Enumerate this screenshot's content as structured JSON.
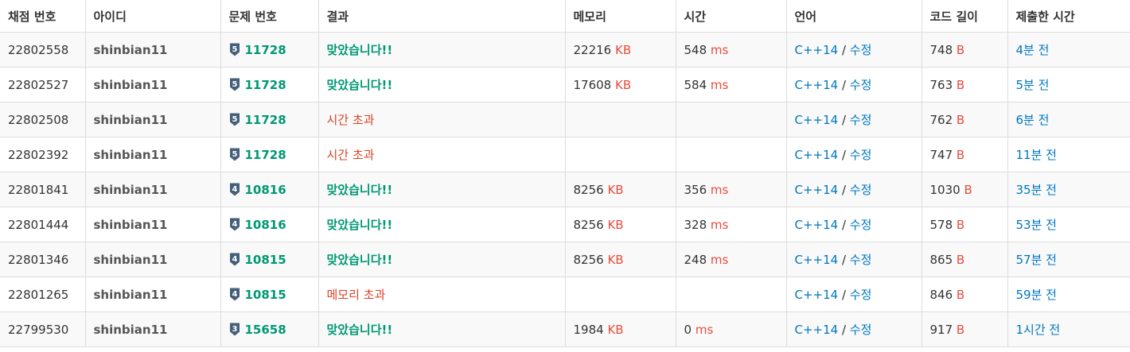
{
  "colors": {
    "accepted": "#009874",
    "fail": "#dd4124",
    "unit": "#e74c3c",
    "link": "#0076c0",
    "tier_badge": "#435f7a"
  },
  "headers": [
    "채점 번호",
    "아이디",
    "문제 번호",
    "결과",
    "메모리",
    "시간",
    "언어",
    "코드 길이",
    "제출한 시간"
  ],
  "rows": [
    {
      "id": "22802558",
      "user": "shinbian11",
      "tier": "5",
      "problem": "11728",
      "result": "맞았습니다!!",
      "status": "ok",
      "memory": "22216",
      "memory_unit": "KB",
      "time": "548",
      "time_unit": "ms",
      "lang": "C++14",
      "sep": " / ",
      "edit": "수정",
      "length": "748",
      "length_unit": "B",
      "ago": "4분 전"
    },
    {
      "id": "22802527",
      "user": "shinbian11",
      "tier": "5",
      "problem": "11728",
      "result": "맞았습니다!!",
      "status": "ok",
      "memory": "17608",
      "memory_unit": "KB",
      "time": "584",
      "time_unit": "ms",
      "lang": "C++14",
      "sep": " / ",
      "edit": "수정",
      "length": "763",
      "length_unit": "B",
      "ago": "5분 전"
    },
    {
      "id": "22802508",
      "user": "shinbian11",
      "tier": "5",
      "problem": "11728",
      "result": "시간 초과",
      "status": "fail",
      "memory": "",
      "memory_unit": "",
      "time": "",
      "time_unit": "",
      "lang": "C++14",
      "sep": " / ",
      "edit": "수정",
      "length": "762",
      "length_unit": "B",
      "ago": "6분 전"
    },
    {
      "id": "22802392",
      "user": "shinbian11",
      "tier": "5",
      "problem": "11728",
      "result": "시간 초과",
      "status": "fail",
      "memory": "",
      "memory_unit": "",
      "time": "",
      "time_unit": "",
      "lang": "C++14",
      "sep": " / ",
      "edit": "수정",
      "length": "747",
      "length_unit": "B",
      "ago": "11분 전"
    },
    {
      "id": "22801841",
      "user": "shinbian11",
      "tier": "4",
      "problem": "10816",
      "result": "맞았습니다!!",
      "status": "ok",
      "memory": "8256",
      "memory_unit": "KB",
      "time": "356",
      "time_unit": "ms",
      "lang": "C++14",
      "sep": " / ",
      "edit": "수정",
      "length": "1030",
      "length_unit": "B",
      "ago": "35분 전"
    },
    {
      "id": "22801444",
      "user": "shinbian11",
      "tier": "4",
      "problem": "10816",
      "result": "맞았습니다!!",
      "status": "ok",
      "memory": "8256",
      "memory_unit": "KB",
      "time": "328",
      "time_unit": "ms",
      "lang": "C++14",
      "sep": " / ",
      "edit": "수정",
      "length": "578",
      "length_unit": "B",
      "ago": "53분 전"
    },
    {
      "id": "22801346",
      "user": "shinbian11",
      "tier": "4",
      "problem": "10815",
      "result": "맞았습니다!!",
      "status": "ok",
      "memory": "8256",
      "memory_unit": "KB",
      "time": "248",
      "time_unit": "ms",
      "lang": "C++14",
      "sep": " / ",
      "edit": "수정",
      "length": "865",
      "length_unit": "B",
      "ago": "57분 전"
    },
    {
      "id": "22801265",
      "user": "shinbian11",
      "tier": "4",
      "problem": "10815",
      "result": "메모리 초과",
      "status": "fail",
      "memory": "",
      "memory_unit": "",
      "time": "",
      "time_unit": "",
      "lang": "C++14",
      "sep": " / ",
      "edit": "수정",
      "length": "846",
      "length_unit": "B",
      "ago": "59분 전"
    },
    {
      "id": "22799530",
      "user": "shinbian11",
      "tier": "3",
      "problem": "15658",
      "result": "맞았습니다!!",
      "status": "ok",
      "memory": "1984",
      "memory_unit": "KB",
      "time": "0",
      "time_unit": "ms",
      "lang": "C++14",
      "sep": " / ",
      "edit": "수정",
      "length": "917",
      "length_unit": "B",
      "ago": "1시간 전"
    }
  ]
}
